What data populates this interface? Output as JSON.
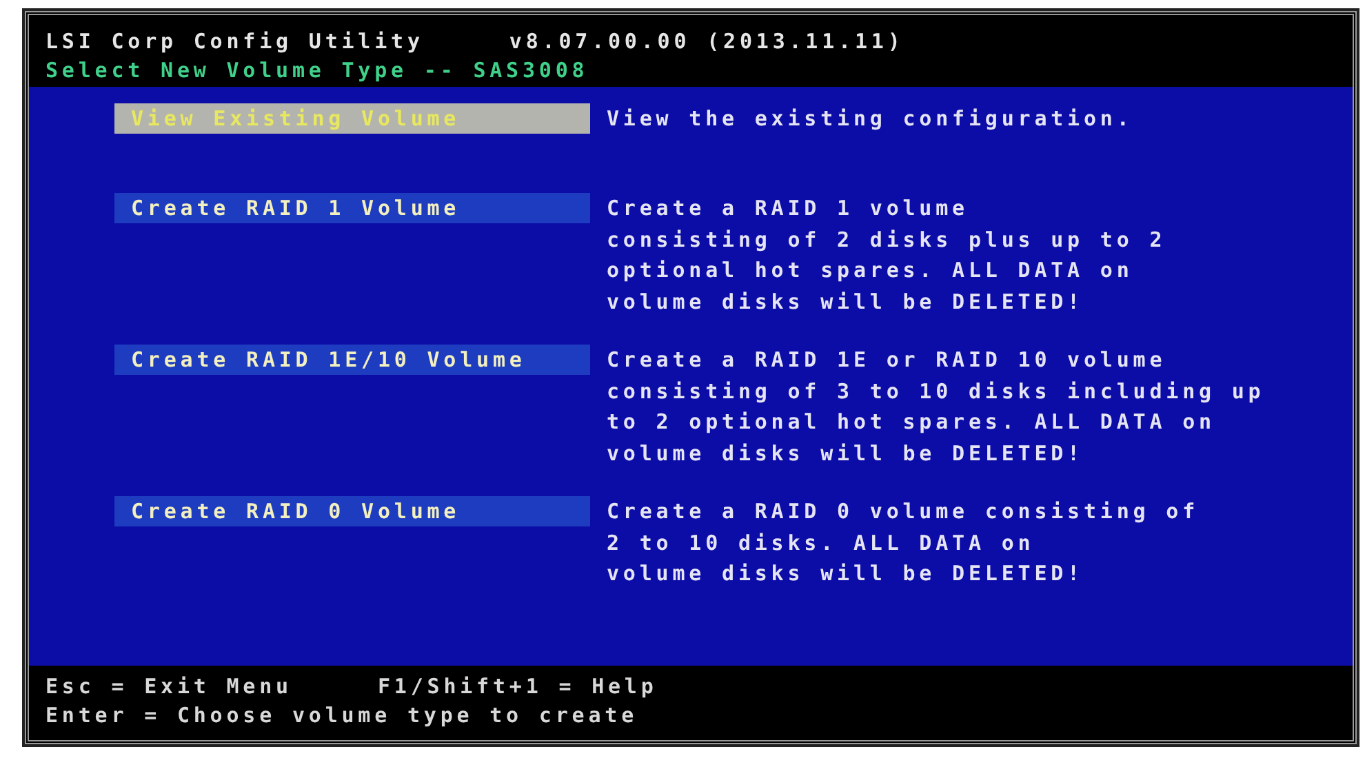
{
  "header": {
    "title": "LSI Corp Config Utility",
    "version": "v8.07.00.00 (2013.11.11)",
    "subtitle": "Select New Volume Type -- SAS3008"
  },
  "menu": [
    {
      "label": "View Existing Volume",
      "selected": true,
      "description": [
        "View the existing configuration."
      ]
    },
    {
      "label": "Create RAID 1 Volume",
      "selected": false,
      "description": [
        "Create a RAID 1 volume",
        "consisting of 2 disks plus up to 2",
        "optional hot spares. ALL DATA on",
        "volume disks will be DELETED!"
      ]
    },
    {
      "label": "Create RAID 1E/10 Volume",
      "selected": false,
      "description": [
        "Create a RAID 1E or RAID 10 volume",
        "consisting of 3 to 10 disks including up",
        "to 2 optional hot spares. ALL DATA on",
        "volume disks will be DELETED!"
      ]
    },
    {
      "label": "Create RAID 0 Volume",
      "selected": false,
      "description": [
        "Create a RAID 0 volume consisting of",
        "2 to 10 disks. ALL DATA on",
        "volume disks will be DELETED!"
      ]
    }
  ],
  "footer": [
    [
      "Esc = Exit Menu",
      "F1/Shift+1 = Help"
    ],
    [
      "Enter = Choose volume type to create"
    ]
  ]
}
